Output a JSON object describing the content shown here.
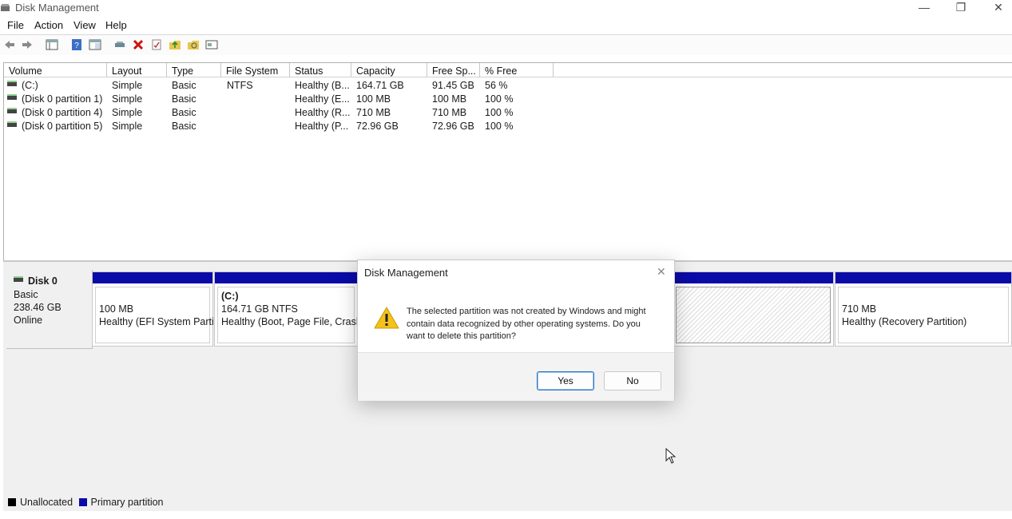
{
  "window": {
    "title": "Disk Management"
  },
  "menu": [
    "File",
    "Action",
    "View",
    "Help"
  ],
  "toolbar": [
    "back-icon",
    "forward-icon",
    "disk-list-icon",
    "help-icon",
    "console-icon",
    "connect-icon",
    "delete-icon",
    "properties-icon",
    "up-folder-icon",
    "open-folder-icon",
    "view-icon"
  ],
  "table": {
    "columns": [
      "Volume",
      "Layout",
      "Type",
      "File System",
      "Status",
      "Capacity",
      "Free Sp...",
      "% Free"
    ],
    "rows": [
      [
        "(C:)",
        "Simple",
        "Basic",
        "NTFS",
        "Healthy (B...",
        "164.71 GB",
        "91.45 GB",
        "56 %"
      ],
      [
        "(Disk 0 partition 1)",
        "Simple",
        "Basic",
        "",
        "Healthy (E...",
        "100 MB",
        "100 MB",
        "100 %"
      ],
      [
        "(Disk 0 partition 4)",
        "Simple",
        "Basic",
        "",
        "Healthy (R...",
        "710 MB",
        "710 MB",
        "100 %"
      ],
      [
        "(Disk 0 partition 5)",
        "Simple",
        "Basic",
        "",
        "Healthy (P...",
        "72.96 GB",
        "72.96 GB",
        "100 %"
      ]
    ]
  },
  "disk": {
    "name": "Disk 0",
    "type": "Basic",
    "size": "238.46 GB",
    "status": "Online"
  },
  "partitions": {
    "efi": {
      "size": "100 MB",
      "status": "Healthy (EFI System Partiti"
    },
    "c": {
      "label": "(C:)",
      "size": "164.71 GB NTFS",
      "status": "Healthy (Boot, Page File, Crash D"
    },
    "recovery": {
      "size": "710 MB",
      "status": "Healthy (Recovery Partition)"
    }
  },
  "legend": {
    "unallocated": "Unallocated",
    "primary": "Primary partition"
  },
  "dialog": {
    "title": "Disk Management",
    "message": "The selected partition was not created by Windows and might contain data recognized by other operating systems. Do you want to delete this partition?",
    "yes": "Yes",
    "no": "No"
  },
  "colors": {
    "primary_partition": "#0a0aa8",
    "unallocated": "#000000",
    "accent": "#2c74c7"
  }
}
